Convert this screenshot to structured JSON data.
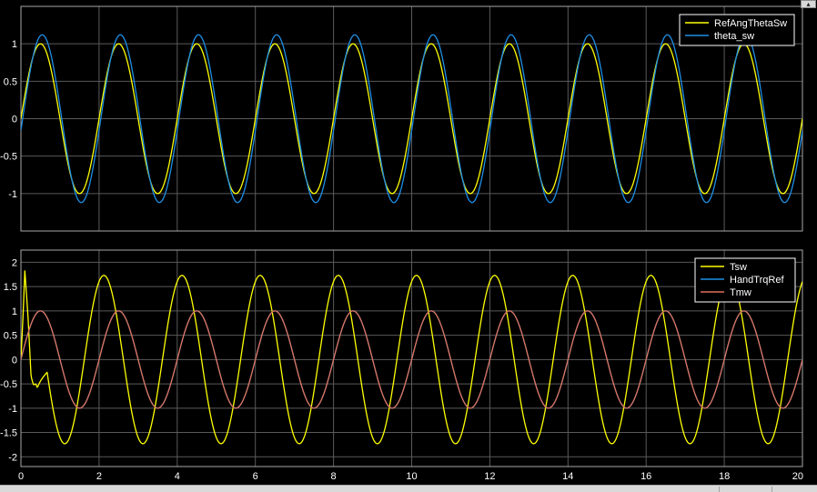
{
  "window": {
    "expand_icon": "expand-icon"
  },
  "theme": {
    "background": "#000000",
    "axes_border": "#a8a8a8",
    "grid": "#5a5a5a",
    "tick_text": "#ffffff",
    "legend_bg": "#000000",
    "legend_border": "#ffffff",
    "legend_text": "#ffffff"
  },
  "chart_data": [
    {
      "type": "line",
      "title": "",
      "xlabel": "",
      "ylabel": "",
      "xlim": [
        0,
        20
      ],
      "ylim": [
        -1.5,
        1.5
      ],
      "xticks": [
        0,
        2,
        4,
        6,
        8,
        10,
        12,
        14,
        16,
        18,
        20
      ],
      "xtick_labels_shown": false,
      "yticks": [
        -1,
        -0.5,
        0,
        0.5,
        1
      ],
      "ytick_labels": [
        "-1",
        "-0.5",
        "0",
        "0.5",
        "1"
      ],
      "grid": true,
      "legend_position": "top-right",
      "series": [
        {
          "name": "RefAngThetaSw",
          "color": "#ffff00",
          "kind": "sine",
          "amplitude": 1.0,
          "frequency_hz": 0.5,
          "phase_deg": 0,
          "offset": 0
        },
        {
          "name": "theta_sw",
          "color": "#1e8fe6",
          "kind": "sine",
          "amplitude": 1.12,
          "frequency_hz": 0.5,
          "phase_deg": -8,
          "offset": 0
        }
      ]
    },
    {
      "type": "line",
      "title": "",
      "xlabel": "",
      "ylabel": "",
      "xlim": [
        0,
        20
      ],
      "ylim": [
        -2.2,
        2.25
      ],
      "xticks": [
        0,
        2,
        4,
        6,
        8,
        10,
        12,
        14,
        16,
        18,
        20
      ],
      "xtick_labels": [
        "0",
        "2",
        "4",
        "6",
        "8",
        "10",
        "12",
        "14",
        "16",
        "18",
        "20"
      ],
      "xtick_labels_shown": true,
      "yticks": [
        -2,
        -1.5,
        -1,
        -0.5,
        0,
        0.5,
        1,
        1.5,
        2
      ],
      "ytick_labels": [
        "-2",
        "-1.5",
        "-1",
        "-0.5",
        "0",
        "0.5",
        "1",
        "1.5",
        "2"
      ],
      "grid": true,
      "legend_position": "top-right",
      "series": [
        {
          "name": "Tsw",
          "color": "#ffff00",
          "kind": "sine",
          "amplitude": 1.73,
          "frequency_hz": 0.5,
          "phase_deg": 68,
          "offset": 0,
          "transient": [
            [
              0,
              0.0
            ],
            [
              0.06,
              1.0
            ],
            [
              0.1,
              1.83
            ],
            [
              0.18,
              0.9
            ],
            [
              0.26,
              -0.35
            ],
            [
              0.32,
              -0.52
            ],
            [
              0.38,
              -0.5
            ],
            [
              0.42,
              -0.58
            ]
          ]
        },
        {
          "name": "HandTrqRef",
          "color": "#1e8fe6",
          "kind": "sine",
          "amplitude": 1.0,
          "frequency_hz": 0.5,
          "phase_deg": 0,
          "offset": 0
        },
        {
          "name": "Tmw",
          "color": "#e0705a",
          "kind": "sine",
          "amplitude": 1.0,
          "frequency_hz": 0.5,
          "phase_deg": 0,
          "offset": 0
        }
      ]
    }
  ]
}
